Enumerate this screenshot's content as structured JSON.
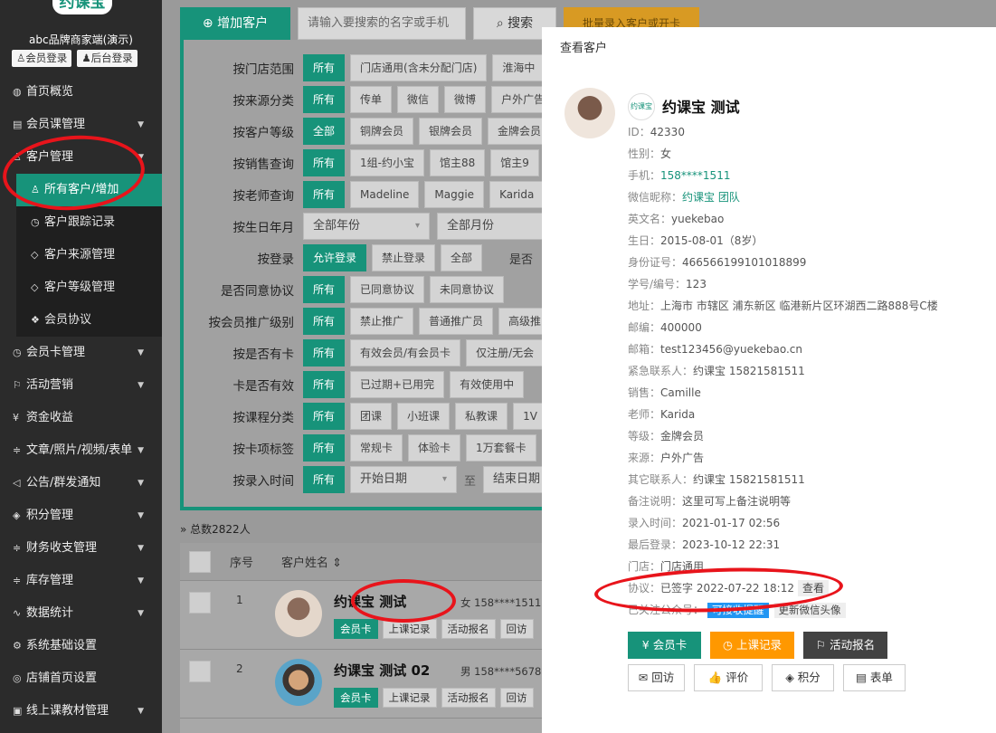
{
  "sidebar": {
    "logo": "约课宝",
    "brand": "abc品牌商家端(演示)",
    "member_login": "会员登录",
    "admin_login": "后台登录",
    "items": [
      {
        "label": "首页概览",
        "icon": "◍",
        "caret": ""
      },
      {
        "label": "会员课管理",
        "icon": "▤",
        "caret": "▼"
      },
      {
        "label": "客户管理",
        "icon": "♙",
        "caret": "▼"
      }
    ],
    "sub_items": [
      {
        "label": "所有客户/增加",
        "icon": "♙"
      },
      {
        "label": "客户跟踪记录",
        "icon": "◷"
      },
      {
        "label": "客户来源管理",
        "icon": "◇"
      },
      {
        "label": "客户等级管理",
        "icon": "◇"
      },
      {
        "label": "会员协议",
        "icon": "❖"
      }
    ],
    "items_after": [
      {
        "label": "会员卡管理",
        "icon": "◷",
        "caret": "▼"
      },
      {
        "label": "活动营销",
        "icon": "⚐",
        "caret": "▼"
      },
      {
        "label": "资金收益",
        "icon": "¥",
        "caret": ""
      },
      {
        "label": "文章/照片/视频/表单",
        "icon": "≑",
        "caret": "▼"
      },
      {
        "label": "公告/群发通知",
        "icon": "◁",
        "caret": "▼"
      },
      {
        "label": "积分管理",
        "icon": "◈",
        "caret": "▼"
      },
      {
        "label": "财务收支管理",
        "icon": "≑",
        "caret": "▼"
      },
      {
        "label": "库存管理",
        "icon": "≑",
        "caret": "▼"
      },
      {
        "label": "数据统计",
        "icon": "∿",
        "caret": "▼"
      },
      {
        "label": "系统基础设置",
        "icon": "⚙",
        "caret": ""
      },
      {
        "label": "店铺首页设置",
        "icon": "◎",
        "caret": ""
      },
      {
        "label": "线上课教材管理",
        "icon": "▣",
        "caret": "▼"
      }
    ]
  },
  "toolbar": {
    "add_label": "增加客户",
    "search_placeholder": "请输入要搜索的名字或手机",
    "search_label": "搜索",
    "import_label": "批量录入客户或开卡"
  },
  "filters": [
    {
      "label": "按门店范围",
      "options": [
        "所有",
        "门店通用(含未分配门店)",
        "淮海中"
      ]
    },
    {
      "label": "按来源分类",
      "options": [
        "所有",
        "传单",
        "微信",
        "微博",
        "户外广告"
      ]
    },
    {
      "label": "按客户等级",
      "options": [
        "全部",
        "铜牌会员",
        "银牌会员",
        "金牌会员"
      ]
    },
    {
      "label": "按销售查询",
      "options": [
        "所有",
        "1组-约小宝",
        "馆主88",
        "馆主9"
      ]
    },
    {
      "label": "按老师查询",
      "options": [
        "所有",
        "Madeline",
        "Maggie",
        "Karida"
      ]
    },
    {
      "label": "按生日年月",
      "selects": [
        "全部年份",
        "全部月份"
      ]
    },
    {
      "label": "按登录",
      "options": [
        "允许登录",
        "禁止登录",
        "全部"
      ],
      "extra": "是否"
    },
    {
      "label": "是否同意协议",
      "options": [
        "所有",
        "已同意协议",
        "未同意协议"
      ]
    },
    {
      "label": "按会员推广级别",
      "options": [
        "所有",
        "禁止推广",
        "普通推广员",
        "高级推"
      ]
    },
    {
      "label": "按是否有卡",
      "options": [
        "所有",
        "有效会员/有会员卡",
        "仅注册/无会"
      ]
    },
    {
      "label": "卡是否有效",
      "options": [
        "所有",
        "已过期+已用完",
        "有效使用中"
      ]
    },
    {
      "label": "按课程分类",
      "options": [
        "所有",
        "团课",
        "小班课",
        "私教课",
        "1V"
      ]
    },
    {
      "label": "按卡项标签",
      "options": [
        "所有",
        "常规卡",
        "体验卡",
        "1万套餐卡"
      ]
    },
    {
      "label": "按录入时间",
      "options": [
        "所有"
      ],
      "date_start": "开始日期",
      "to": "至",
      "date_end": "结束日期"
    }
  ],
  "table": {
    "total": "总数2822人",
    "col_seq": "序号",
    "col_name": "客户姓名",
    "rows": [
      {
        "seq": "1",
        "name": "约课宝 测试",
        "meta": "女 158****1511",
        "actions": [
          "会员卡",
          "上课记录",
          "活动报名",
          "回访"
        ]
      },
      {
        "seq": "2",
        "name": "约课宝 测试 02",
        "meta": "男 158****5678",
        "actions": [
          "会员卡",
          "上课记录",
          "活动报名",
          "回访"
        ]
      }
    ]
  },
  "detail": {
    "title": "查看客户",
    "logo": "约课宝",
    "name": "约课宝 测试",
    "fields": [
      {
        "k": "ID：",
        "v": "42330"
      },
      {
        "k": "性别：",
        "v": "女"
      },
      {
        "k": "手机：",
        "v": "158****1511",
        "link": true
      },
      {
        "k": "微信昵称：",
        "v": "约课宝 团队",
        "link": true
      },
      {
        "k": "英文名：",
        "v": "yuekebao"
      },
      {
        "k": "生日：",
        "v": "2015-08-01（8岁）"
      },
      {
        "k": "身份证号：",
        "v": "466566199101018899"
      },
      {
        "k": "学号/编号：",
        "v": "123"
      },
      {
        "k": "地址：",
        "v": "上海市 市辖区 浦东新区 临港新片区环湖西二路888号C楼"
      },
      {
        "k": "邮编：",
        "v": "400000"
      },
      {
        "k": "邮箱：",
        "v": "test123456@yuekebao.cn"
      },
      {
        "k": "紧急联系人：",
        "v": "约课宝 15821581511"
      },
      {
        "k": "销售：",
        "v": "Camille"
      },
      {
        "k": "老师：",
        "v": "Karida"
      },
      {
        "k": "等级：",
        "v": "金牌会员"
      },
      {
        "k": "来源：",
        "v": "户外广告"
      },
      {
        "k": "其它联系人：",
        "v": "约课宝 15821581511"
      },
      {
        "k": "备注说明：",
        "v": "这里可写上备注说明等"
      },
      {
        "k": "录入时间：",
        "v": "2021-01-17 02:56"
      },
      {
        "k": "最后登录：",
        "v": "2023-10-12 22:31"
      },
      {
        "k": "门店：",
        "v": "门店通用"
      }
    ],
    "agreement_label": "协议：",
    "agreement_value": "已签字 2022-07-22 18:12",
    "agreement_view": "查看",
    "wechat_label": "已关注公众号：",
    "wechat_badge": "可接收提醒",
    "wechat_update": "更新微信头像",
    "buttons_primary": [
      "会员卡",
      "上课记录",
      "活动报名"
    ],
    "buttons_primary_icons": [
      "¥",
      "◷",
      "⚐"
    ],
    "buttons_secondary": [
      "回访",
      "评价",
      "积分",
      "表单"
    ],
    "buttons_secondary_icons": [
      "✉",
      "👍",
      "◈",
      "▤"
    ]
  },
  "colors": {
    "accent": "#17937a",
    "annotation": "#e8141b",
    "orange": "#ff9800",
    "dark": "#424242"
  }
}
